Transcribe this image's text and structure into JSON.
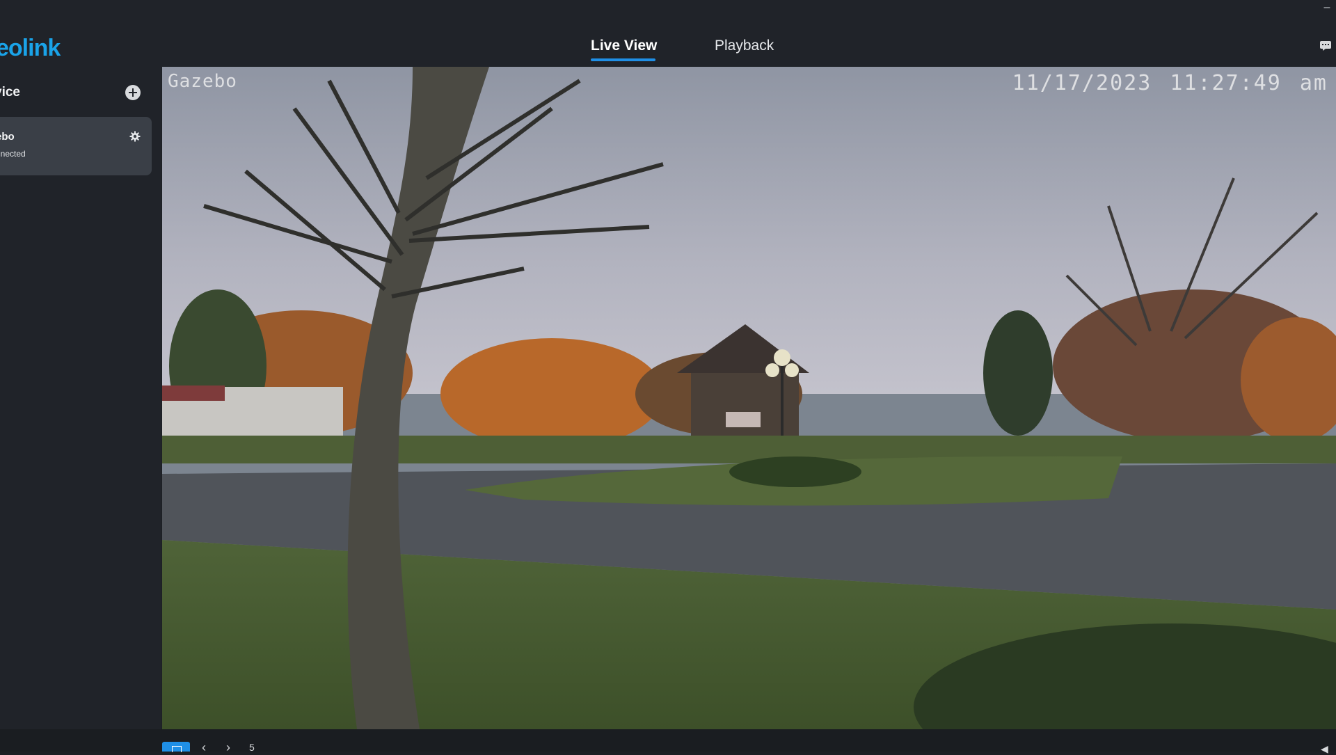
{
  "app": {
    "logo_text": "eolink"
  },
  "tabs": [
    {
      "label": "Live View",
      "active": true
    },
    {
      "label": "Playback",
      "active": false
    }
  ],
  "sidebar": {
    "title": "vice",
    "devices": [
      {
        "name": "ebo",
        "status": "nnected"
      }
    ]
  },
  "video": {
    "osd_camera_name": "Gazebo",
    "osd_timestamp": "11/17/2023 11:27:49 am"
  },
  "toolbar": {
    "prev_label": "‹",
    "next_label": "›",
    "extra_label": "5",
    "volume_label": "◀"
  },
  "colors": {
    "accent": "#1f8fe6",
    "logo": "#1aa3e8",
    "sidebar_bg": "#202329",
    "card_bg": "#3a3f47"
  },
  "icons": {
    "add": "plus-circle-icon",
    "settings": "gear-icon",
    "message": "message-icon",
    "grid": "grid-layout-icon"
  }
}
